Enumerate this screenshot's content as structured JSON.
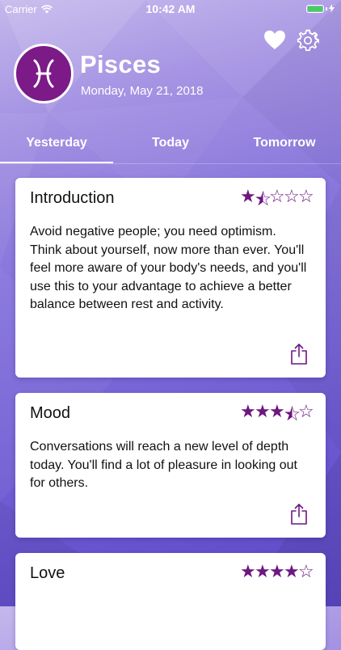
{
  "status": {
    "carrier": "Carrier",
    "time": "10:42 AM"
  },
  "header": {
    "sign_name": "Pisces",
    "date": "Monday, May 21, 2018",
    "sign_icon": "pisces-symbol-icon"
  },
  "tabs": [
    {
      "label": "Yesterday",
      "selected": true
    },
    {
      "label": "Today",
      "selected": false
    },
    {
      "label": "Tomorrow",
      "selected": false
    }
  ],
  "cards": [
    {
      "title": "Introduction",
      "rating": "1.5 of 5",
      "stars": [
        "★",
        "⯪",
        "☆",
        "☆",
        "☆"
      ],
      "body": "Avoid negative people; you need optimism. Think about yourself, now more than ever. You'll feel more aware of your body's needs, and you'll use this to your advantage to achieve a better balance between rest and activity."
    },
    {
      "title": "Mood",
      "rating": "3.5 of 5",
      "stars": [
        "★",
        "★",
        "★",
        "⯪",
        "☆"
      ],
      "body": "Conversations will reach a new level of depth today. You'll find a lot of pleasure in looking out for others."
    },
    {
      "title": "Love",
      "rating": "4 of 5",
      "stars": [
        "★",
        "★",
        "★",
        "★",
        "☆"
      ],
      "body": ""
    }
  ],
  "colors": {
    "accent": "#6e1680",
    "avatar_bg": "#7c1a88",
    "battery": "#3fd552"
  }
}
